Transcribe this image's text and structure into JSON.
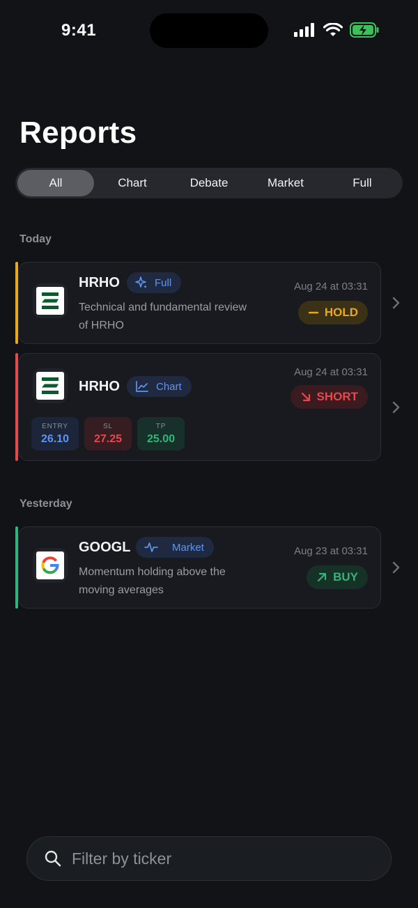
{
  "status_bar": {
    "time": "9:41"
  },
  "page_title": "Reports",
  "filters": [
    {
      "label": "All",
      "active": true
    },
    {
      "label": "Chart",
      "active": false
    },
    {
      "label": "Debate",
      "active": false
    },
    {
      "label": "Market",
      "active": false
    },
    {
      "label": "Full",
      "active": false
    }
  ],
  "sections": [
    {
      "label": "Today",
      "reports": [
        {
          "ticker": "HRHO",
          "type_label": "Full",
          "type_icon": "sparkle-icon",
          "description": "Technical and fundamental review of HRHO",
          "date": "Aug 24 at 03:31",
          "signal": "HOLD",
          "signal_icon": "minus-icon",
          "accent_color": "#e8a820"
        },
        {
          "ticker": "HRHO",
          "type_label": "Chart",
          "type_icon": "line-chart-icon",
          "date": "Aug 24 at 03:31",
          "signal": "SHORT",
          "signal_icon": "arrow-down-right-icon",
          "accent_color": "#e5484d",
          "levels": [
            {
              "label": "ENTRY",
              "value": "26.10"
            },
            {
              "label": "SL",
              "value": "27.25"
            },
            {
              "label": "TP",
              "value": "25.00"
            }
          ]
        }
      ]
    },
    {
      "label": "Yesterday",
      "reports": [
        {
          "ticker": "GOOGL",
          "type_label": "Market",
          "type_icon": "pulse-icon",
          "description": "Momentum holding above the moving averages",
          "date": "Aug 23 at 03:31",
          "signal": "BUY",
          "signal_icon": "arrow-up-right-icon",
          "accent_color": "#2fb67c"
        }
      ]
    }
  ],
  "search": {
    "placeholder": "Filter by ticker",
    "value": ""
  },
  "colors": {
    "background": "#121317",
    "hold": "#e8a820",
    "short": "#e5484d",
    "buy": "#2fb67c",
    "badge_text": "#5f95f0"
  }
}
